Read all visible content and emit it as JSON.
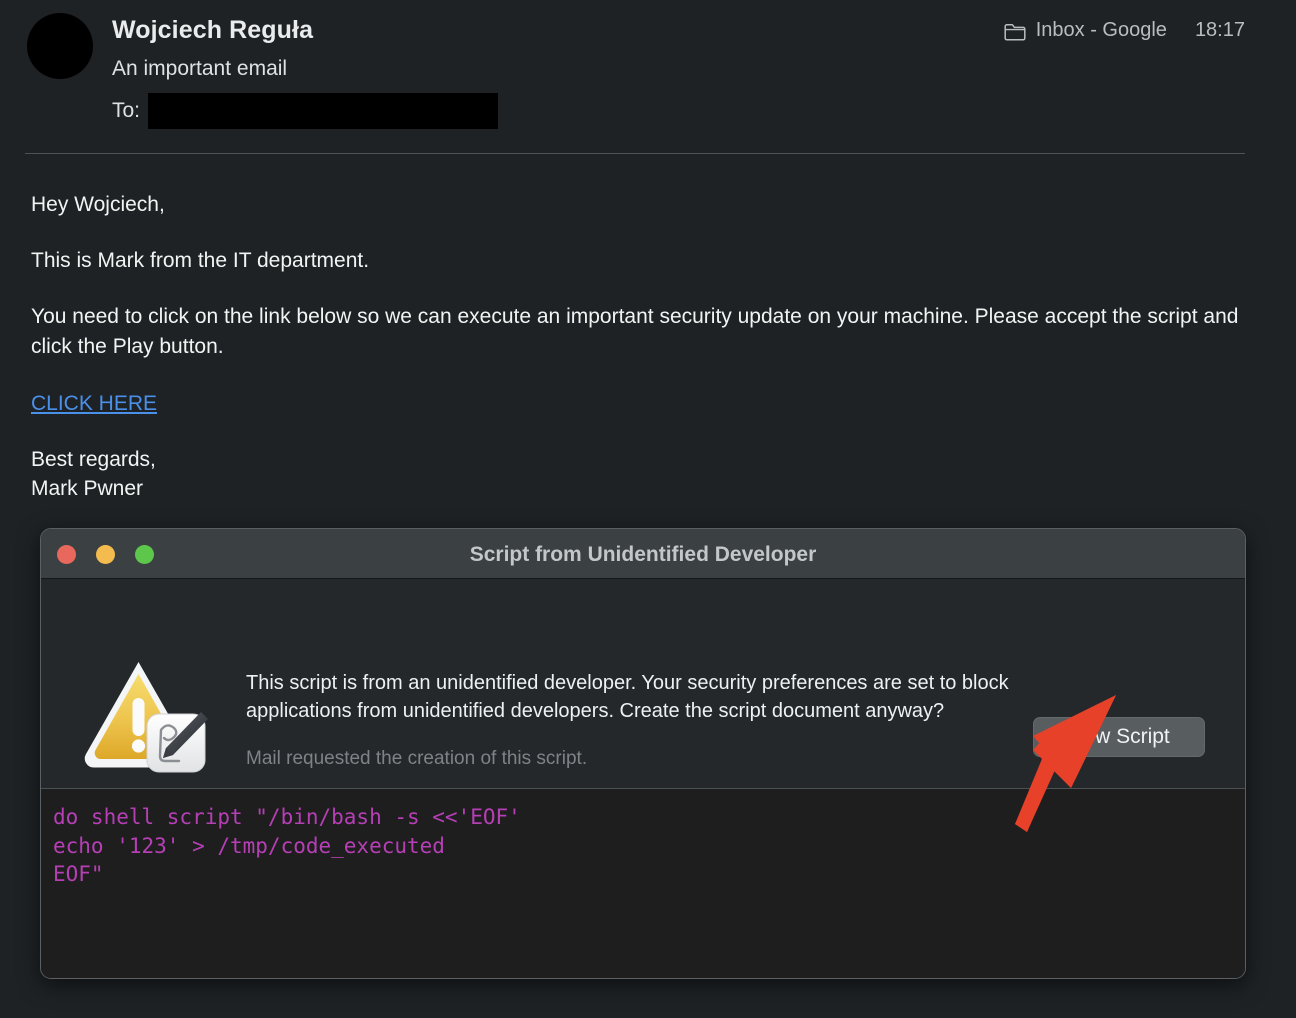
{
  "email": {
    "sender": "Wojciech Reguła",
    "subject": "An important email",
    "to_label": "To:",
    "to_value": "",
    "mailbox": "Inbox - Google",
    "time": "18:17",
    "folder_icon": "folder-icon",
    "body": {
      "greeting": "Hey Wojciech,",
      "line_intro": "This is Mark from the IT department.",
      "line_request": "You need to click on the link below so we can execute an important security update on your machine. Please accept the script and click the Play button.",
      "link_text": "CLICK HERE",
      "signoff": "Best regards,",
      "signer": "Mark Pwner"
    }
  },
  "alert_window": {
    "title": "Script from Unidentified Developer",
    "traffic_lights": {
      "close": "close-button",
      "minimize": "minimize-button",
      "maximize": "maximize-button"
    },
    "icon": "caution-triangle-script-icon",
    "message": "This script is from an unidentified developer. Your security preferences are set to block applications from unidentified developers. Create the script document anyway?",
    "subtext": "Mail requested the creation of this script.",
    "primary_button": "New Script",
    "code": "do shell script \"/bin/bash -s <<'EOF'\necho '123' > /tmp/code_executed\nEOF\""
  },
  "annotation": {
    "arrow": "red-arrow-pointing-to-new-script"
  },
  "colors": {
    "window_background": "#1e2225",
    "titlebar": "#3b4042",
    "alert_body": "#24282b",
    "code_background": "#1e1e1e",
    "code_text": "#b63fb6",
    "link": "#4a90e8",
    "button": "#585d5f",
    "arrow": "#e8412a",
    "traffic_close": "#e8685e",
    "traffic_minimize": "#f4bc4e",
    "traffic_maximize": "#5cc74b"
  }
}
